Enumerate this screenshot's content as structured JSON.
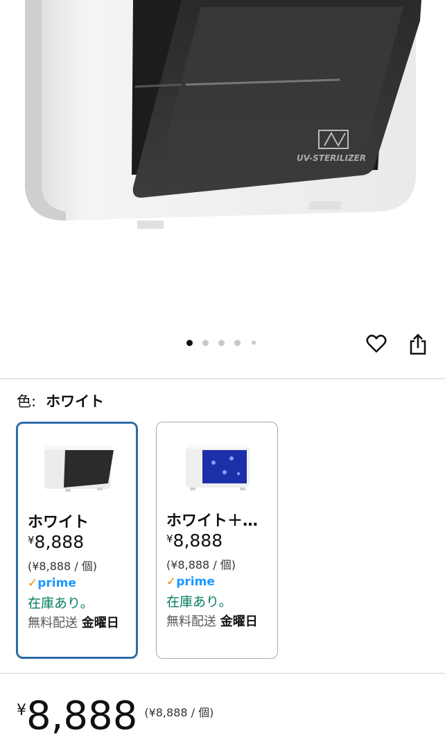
{
  "product": {
    "image_text": "UV-STERILIZER",
    "image_alt": "product-image",
    "carousel": {
      "count": 5,
      "active": 1
    }
  },
  "actions": {
    "favorite_icon": "heart-icon",
    "share_icon": "share-icon"
  },
  "color": {
    "label": "色:",
    "selected": "ホワイト"
  },
  "variants": [
    {
      "name": "ホワイト",
      "yen": "¥",
      "price": "8,888",
      "unit_price": "(¥8,888 / 個)",
      "prime_check": "✓",
      "prime": "prime",
      "stock": "在庫あり。",
      "ship_label": "無料配送",
      "ship_day": "金曜日",
      "selected": true
    },
    {
      "name": "ホワイト＋…",
      "yen": "¥",
      "price": "8,888",
      "unit_price": "(¥8,888 / 個)",
      "prime_check": "✓",
      "prime": "prime",
      "stock": "在庫あり。",
      "ship_label": "無料配送",
      "ship_day": "金曜日",
      "selected": false
    }
  ],
  "main_price": {
    "yen": "¥",
    "amount": "8,888",
    "unit_price": "(¥8,888 / 個)"
  }
}
